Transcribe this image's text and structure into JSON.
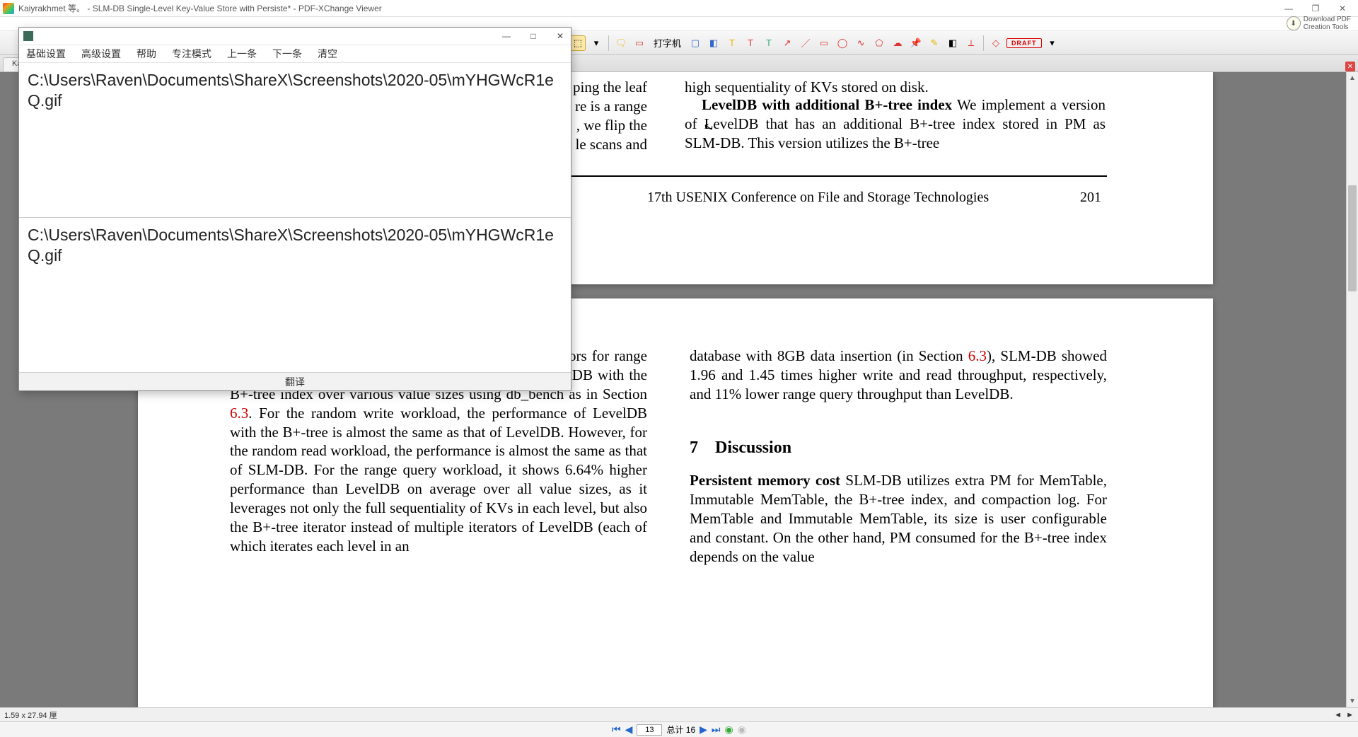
{
  "window": {
    "title": "Kaiyrakhmet 等。 - SLM-DB Single-Level Key-Value Store with Persiste* - PDF-XChange Viewer",
    "min_tooltip": "—",
    "max_tooltip": "❐",
    "close_tooltip": "✕"
  },
  "download_tools": {
    "line1": "Download PDF",
    "line2": "Creation Tools"
  },
  "toolbar": {
    "typewriter_label": "打字机",
    "draft_label": "DRAFT"
  },
  "tab": {
    "label": "Ka"
  },
  "statusbar": {
    "position": "1.59 x 27.94 厘"
  },
  "pagenav": {
    "current_page": "13",
    "total_label": "总计 16"
  },
  "popup": {
    "menu": {
      "basic": "基础设置",
      "advanced": "高级设置",
      "help": "帮助",
      "focus": "专注模式",
      "prev": "上一条",
      "next": "下一条",
      "clear": "清空"
    },
    "source_text": "C:\\Users\\Raven\\Documents\\ShareX\\Screenshots\\2020-05\\mYHGWcR1eQ.gif",
    "target_text": "C:\\Users\\Raven\\Documents\\ShareX\\Screenshots\\2020-05\\mYHGWcR1eQ.gif",
    "translate_btn": "翻译"
  },
  "page1": {
    "frag_left_1": "ping the leaf",
    "frag_left_2": "re is a range",
    "frag_left_3": ", we flip the",
    "frag_left_4": "le scans and",
    "frag_right_top": "high sequentiality of KVs stored on disk.",
    "leveldb_heading": "LevelDB with additional B+-tree index",
    "leveldb_body": " We implement a version of LevelDB that has an additional B+-tree index stored in PM as SLM-DB. This version utilizes the B+-tree",
    "footer_conf": "17th USENIX Conference on File and Storage Technologies",
    "footer_page": "201"
  },
  "page2": {
    "left_body_a": "index for random read operations and the B+-tree iterators for range query operations. We evaluate the performance of LevelDB with the B+-tree index over various value sizes using db_bench as in Section ",
    "left_link": "6.3",
    "left_body_b": ". For the random write workload, the performance of LevelDB with the B+-tree is almost the same as that of LevelDB. However, for the random read workload, the performance is almost the same as that of SLM-DB. For the range query workload, it shows 6.64% higher performance than LevelDB on average over all value sizes, as it leverages not only the full sequentiality of KVs in each level, but also the B+-tree iterator instead of multiple iterators of LevelDB (each of which iterates each level in an",
    "right_body_a": "database with 8GB data insertion (in Section ",
    "right_link": "6.3",
    "right_body_b": "), SLM-DB showed 1.96 and 1.45 times higher write and read throughput, respectively, and 11% lower range query throughput than LevelDB.",
    "section_num": "7",
    "section_title": "Discussion",
    "pm_heading": "Persistent memory cost",
    "pm_body": " SLM-DB utilizes extra PM for MemTable, Immutable MemTable, the B+-tree index, and compaction log. For MemTable and Immutable MemTable, its size is user configurable and constant. On the other hand, PM consumed for the B+-tree index depends on the value"
  }
}
